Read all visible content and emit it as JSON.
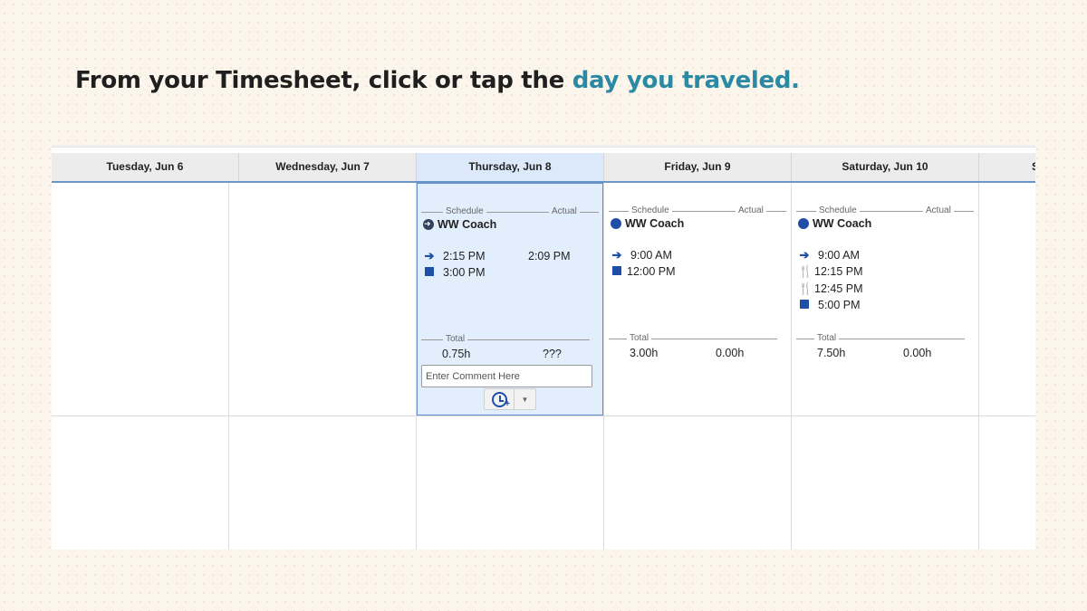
{
  "headline": {
    "text": "From your Timesheet, click or tap the ",
    "accent": "day you traveled."
  },
  "colors": {
    "accent": "#2a8aa3",
    "schedule_blue": "#1e4fa6",
    "selected_bg": "#e2eefc",
    "selected_border": "#5e8ed0"
  },
  "timesheet": {
    "headers": [
      "Tuesday, Jun 6",
      "Wednesday, Jun 7",
      "Thursday, Jun 8",
      "Friday, Jun 9",
      "Saturday, Jun 10",
      "S"
    ],
    "selected_day": "Thursday, Jun 8",
    "labels": {
      "schedule": "Schedule",
      "actual": "Actual",
      "total": "Total"
    },
    "days": {
      "thursday": {
        "title": "WW Coach",
        "title_icon": "arrow-circle-icon",
        "entries": [
          {
            "icon": "arrow-right-icon",
            "time": "2:15 PM",
            "actual": "2:09 PM"
          },
          {
            "icon": "stop-square-icon",
            "time": "3:00 PM"
          }
        ],
        "total_schedule": "0.75h",
        "total_actual": "???",
        "comment_placeholder": "Enter Comment Here"
      },
      "friday": {
        "title": "WW Coach",
        "title_icon": "circle-icon",
        "entries": [
          {
            "icon": "arrow-right-icon",
            "time": "9:00 AM"
          },
          {
            "icon": "stop-square-icon",
            "time": "12:00 PM"
          }
        ],
        "total_schedule": "3.00h",
        "total_actual": "0.00h"
      },
      "saturday": {
        "title": "WW Coach",
        "title_icon": "circle-icon",
        "entries": [
          {
            "icon": "arrow-right-icon",
            "time": "9:00 AM"
          },
          {
            "icon": "meal-icon",
            "time": "12:15 PM"
          },
          {
            "icon": "meal-icon",
            "time": "12:45 PM"
          },
          {
            "icon": "stop-square-icon",
            "time": "5:00 PM"
          }
        ],
        "total_schedule": "7.50h",
        "total_actual": "0.00h"
      }
    }
  }
}
